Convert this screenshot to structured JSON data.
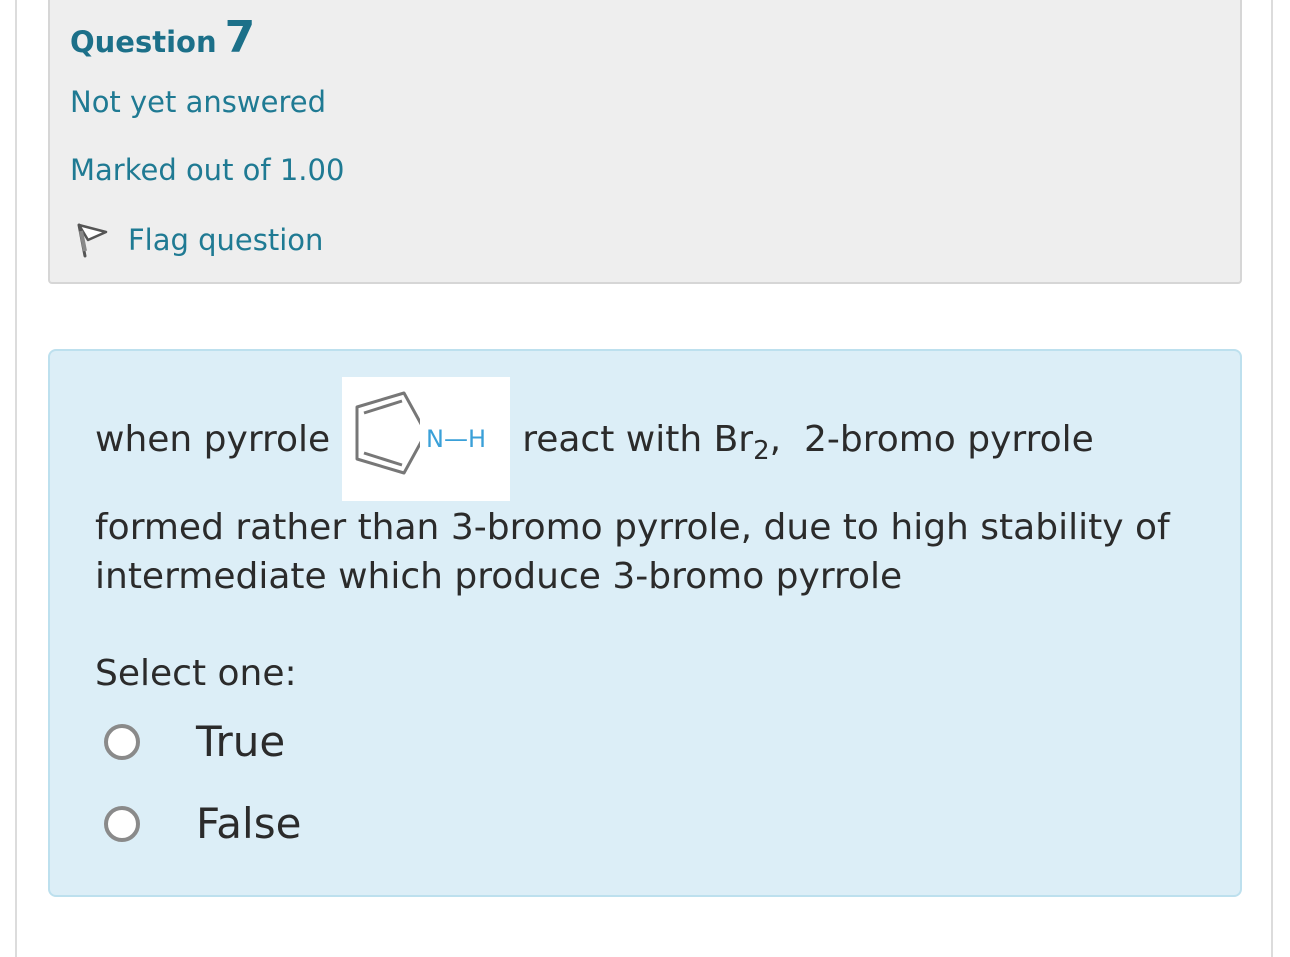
{
  "question": {
    "word": "Question",
    "number": "7",
    "state": "Not yet answered",
    "grade": "Marked out of 1.00",
    "flag_label": "Flag question"
  },
  "content": {
    "text_before_image": "when pyrrole",
    "text_after_image": "react with Br",
    "subscript": "2",
    "text_after_subscript": ",  2-bromo pyrrole",
    "paragraph": "formed rather than 3-bromo pyrrole, due to high stability of intermediate which produce 3-bromo pyrrole",
    "molecule_label": "N—H",
    "select_prompt": "Select one:",
    "options": [
      {
        "label": "True",
        "selected": false
      },
      {
        "label": "False",
        "selected": false
      }
    ]
  },
  "colors": {
    "link": "#1f7a93",
    "heading": "#1c7089",
    "nitrogen": "#3aa0d8",
    "content_bg": "#dceef7",
    "info_bg": "#eeeeee"
  }
}
